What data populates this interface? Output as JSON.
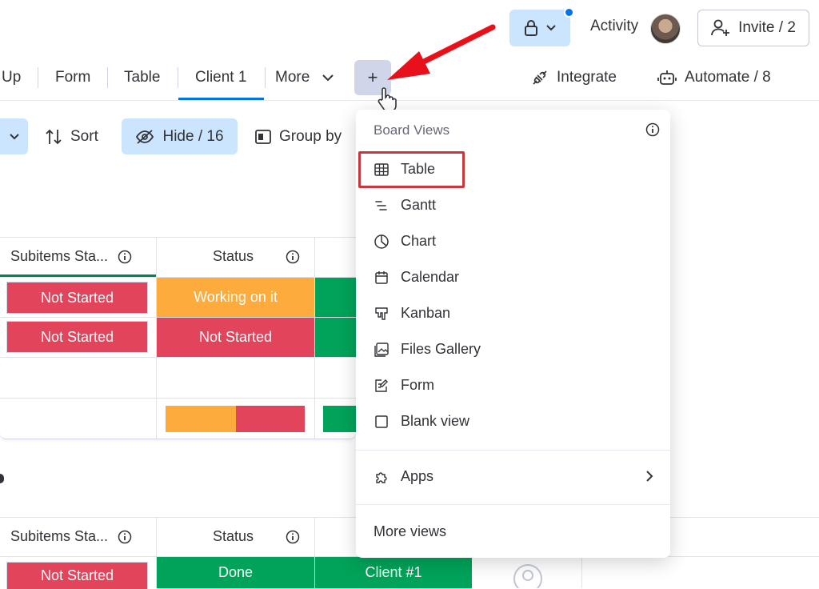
{
  "topbar": {
    "activity_label": "Activity",
    "invite_label": "Invite / 2"
  },
  "tabs": [
    {
      "label": "Up"
    },
    {
      "label": "Form"
    },
    {
      "label": "Table"
    },
    {
      "label": "Client 1",
      "active": true
    },
    {
      "label": "More"
    }
  ],
  "add_view_label": "+",
  "integrate_label": "Integrate",
  "automate_label": "Automate / 8",
  "toolbar": {
    "sort_label": "Sort",
    "hide_label": "Hide / 16",
    "groupby_label": "Group by"
  },
  "table": {
    "columns": [
      "Subitems Sta...",
      "Status"
    ],
    "group1_rows": [
      {
        "subitems_status": "Not Started",
        "status": "Working on it"
      },
      {
        "subitems_status": "Not Started",
        "status": "Not Started"
      }
    ],
    "group2_row": {
      "subitems_status": "Not Started",
      "status": "Done",
      "client": "Client #1"
    }
  },
  "menu": {
    "title": "Board Views",
    "items": [
      {
        "label": "Table",
        "icon": "table-icon"
      },
      {
        "label": "Gantt",
        "icon": "gantt-icon"
      },
      {
        "label": "Chart",
        "icon": "chart-icon"
      },
      {
        "label": "Calendar",
        "icon": "calendar-icon"
      },
      {
        "label": "Kanban",
        "icon": "kanban-icon"
      },
      {
        "label": "Files Gallery",
        "icon": "gallery-icon"
      },
      {
        "label": "Form",
        "icon": "form-icon"
      },
      {
        "label": "Blank view",
        "icon": "blank-view-icon"
      }
    ],
    "apps_label": "Apps",
    "more_views_label": "More views"
  },
  "colors": {
    "accent": "#0073ea",
    "not_started": "#e2445c",
    "working_on_it": "#fdab3d",
    "done": "#00a359",
    "highlight": "#c8373c",
    "arrow": "#e8101a"
  }
}
